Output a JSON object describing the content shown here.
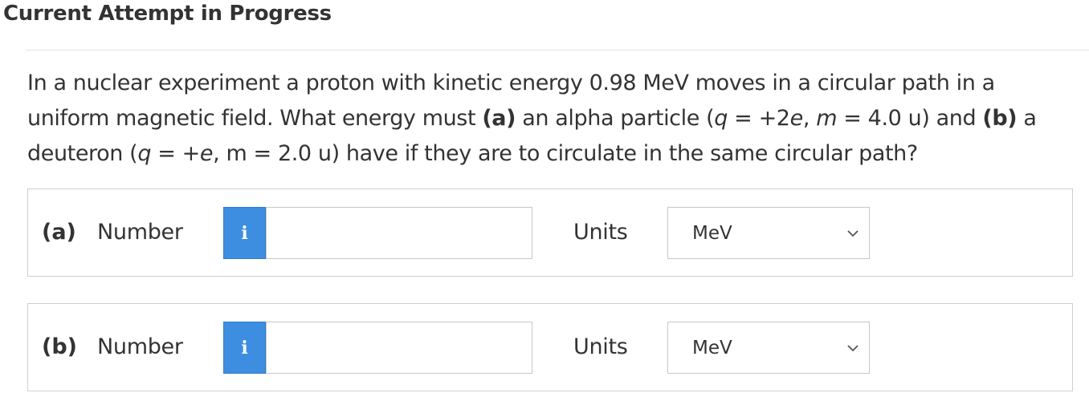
{
  "header": {
    "title": "Current Attempt in Progress"
  },
  "question": {
    "t1": "In a nuclear experiment a proton with kinetic energy 0.98 MeV moves in a circular path in a uniform magnetic field. What energy must ",
    "a_marker": "(a)",
    "t2": " an alpha particle (",
    "q1": "q",
    "t3": " = +2",
    "e1": "e",
    "t4": ", ",
    "m1": "m",
    "t5": " = 4.0 u) and ",
    "b_marker": "(b)",
    "t6": " a deuteron (",
    "q2": "q",
    "t7": " = +",
    "e2": "e",
    "t8": ", m = 2.0 u) have if they are to circulate in the same circular path?"
  },
  "answers": [
    {
      "part": "(a)",
      "number_label": "Number",
      "info_icon": "i",
      "value": "",
      "units_label": "Units",
      "units_selected": "MeV"
    },
    {
      "part": "(b)",
      "number_label": "Number",
      "info_icon": "i",
      "value": "",
      "units_label": "Units",
      "units_selected": "MeV"
    }
  ]
}
